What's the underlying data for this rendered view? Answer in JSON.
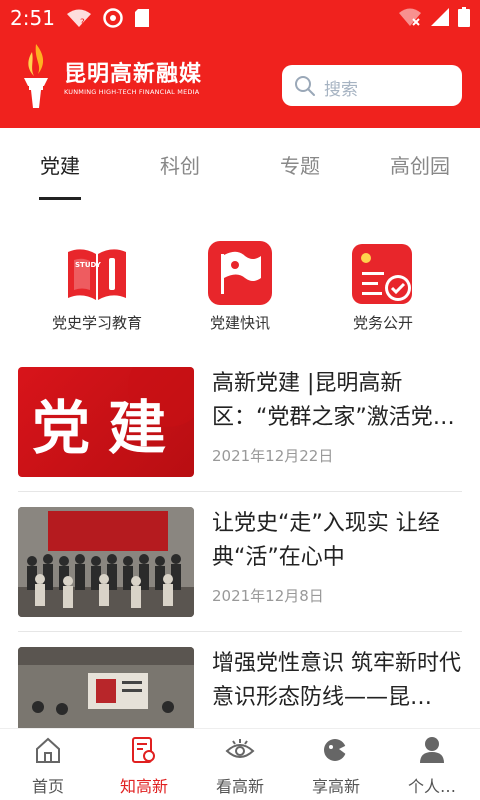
{
  "status_bar": {
    "time": "2:51"
  },
  "brand": {
    "name": "昆明高新融媒",
    "subtitle": "KUNMING HIGH-TECH FINANCIAL MEDIA",
    "primary_color": "#f0221e"
  },
  "search": {
    "placeholder": "搜索"
  },
  "tabs": [
    {
      "label": "党建",
      "active": true
    },
    {
      "label": "科创",
      "active": false
    },
    {
      "label": "专题",
      "active": false
    },
    {
      "label": "高创园",
      "active": false
    }
  ],
  "quick_links": [
    {
      "label": "党史学习教育",
      "icon": "study-book-icon"
    },
    {
      "label": "党建快讯",
      "icon": "party-flag-icon"
    },
    {
      "label": "党务公开",
      "icon": "party-document-icon"
    }
  ],
  "news": [
    {
      "title": "高新党建 |昆明高新区：“党群之家”激活党…",
      "date": "2021年12月22日",
      "thumb_text": "党建"
    },
    {
      "title": "让党史“走”入现实 让经典“活”在心中",
      "date": "2021年12月8日",
      "thumb_text": ""
    },
    {
      "title": "增强党性意识 筑牢新时代意识形态防线——昆…",
      "date": "",
      "thumb_text": ""
    }
  ],
  "bottom_nav": [
    {
      "label": "首页",
      "icon": "home-icon",
      "active": false
    },
    {
      "label": "知高新",
      "icon": "know-icon",
      "active": true
    },
    {
      "label": "看高新",
      "icon": "eye-icon",
      "active": false
    },
    {
      "label": "享高新",
      "icon": "share-icon",
      "active": false
    },
    {
      "label": "个人…",
      "icon": "person-icon",
      "active": false
    }
  ]
}
